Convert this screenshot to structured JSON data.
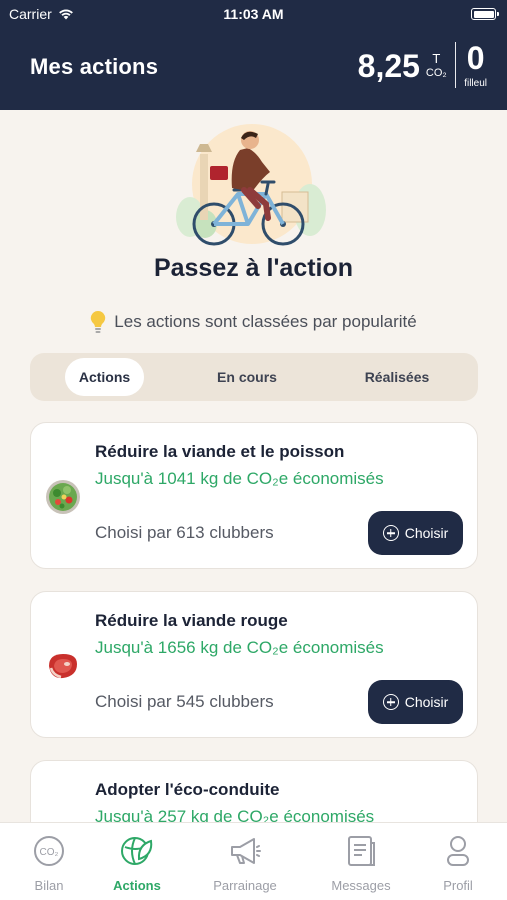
{
  "status_bar": {
    "carrier": "Carrier",
    "time": "11:03 AM"
  },
  "header": {
    "title": "Mes actions",
    "co2_value": "8,25",
    "co2_unit_t": "T",
    "co2_unit_label": "CO₂",
    "sponsor_count": "0",
    "sponsor_label": "filleul"
  },
  "hero": {
    "title": "Passez à l'action",
    "hint": "Les actions sont classées par popularité"
  },
  "tabs": [
    {
      "label": "Actions",
      "active": true
    },
    {
      "label": "En cours",
      "active": false
    },
    {
      "label": "Réalisées",
      "active": false
    }
  ],
  "cards": [
    {
      "icon": "salad-icon",
      "title": "Réduire la viande et le poisson",
      "savings": "Jusqu'à 1041 kg de CO₂e économisés",
      "chosen": "Choisi par 613 clubbers",
      "button": "Choisir"
    },
    {
      "icon": "steak-icon",
      "title": "Réduire la viande rouge",
      "savings": "Jusqu'à 1656 kg de CO₂e économisés",
      "chosen": "Choisi par 545 clubbers",
      "button": "Choisir"
    },
    {
      "icon": "car-icon",
      "title": "Adopter l'éco-conduite",
      "savings": "Jusqu'à 257 kg de CO₂e économisés",
      "chosen": "",
      "button": ""
    }
  ],
  "bottom_nav": [
    {
      "label": "Bilan",
      "icon": "co2-icon",
      "active": false
    },
    {
      "label": "Actions",
      "icon": "leaf-globe-icon",
      "active": true
    },
    {
      "label": "Parrainage",
      "icon": "megaphone-icon",
      "active": false
    },
    {
      "label": "Messages",
      "icon": "messages-icon",
      "active": false
    },
    {
      "label": "Profil",
      "icon": "profile-icon",
      "active": false
    }
  ],
  "colors": {
    "header_bg": "#202b45",
    "accent_green": "#2ea867",
    "page_bg": "#f7f3ee",
    "tab_bg": "#ece4d9",
    "button_bg": "#202b45"
  }
}
